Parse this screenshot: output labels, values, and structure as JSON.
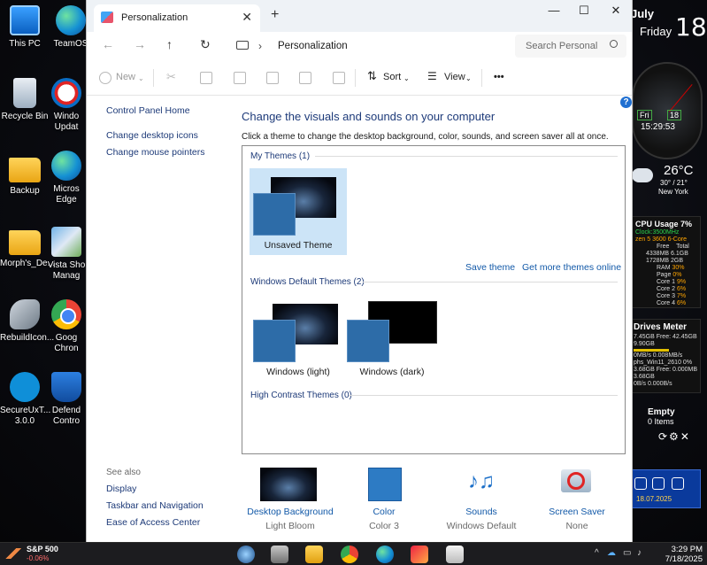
{
  "desktop": {
    "icons": [
      {
        "label": "This PC",
        "icon": "monitor-icon"
      },
      {
        "label": "TeamOS",
        "icon": "edge-icon"
      },
      {
        "label": "Recycle Bin",
        "icon": "recycle-bin-icon"
      },
      {
        "label": "Windo Updat",
        "icon": "blocked-icon"
      },
      {
        "label": "Backup",
        "icon": "folder-icon"
      },
      {
        "label": "Micros Edge",
        "icon": "edge-icon"
      },
      {
        "label": "Morph's_De...",
        "icon": "folder-icon"
      },
      {
        "label": "Vista Sho Manag",
        "icon": "vista-icon"
      },
      {
        "label": "RebuildIcon...",
        "icon": "tool-icon"
      },
      {
        "label": "Goog Chron",
        "icon": "chrome-icon"
      },
      {
        "label": "SecureUxT... 3.0.0",
        "icon": "brush-icon"
      },
      {
        "label": "Defend Contro",
        "icon": "shield-icon"
      }
    ]
  },
  "widgets": {
    "date": {
      "month": "July",
      "weekday": "Friday",
      "day": "18"
    },
    "clock": {
      "day_box": "Fri",
      "date_box": "18",
      "time": "15:29:53"
    },
    "weather": {
      "temp": "26°C",
      "range": "30° / 21°",
      "city": "New York"
    },
    "cpu": {
      "title": "CPU Usage",
      "percent": "7%",
      "clock": "Clock:3500MHz",
      "model": "zen 5 3600 6-Core",
      "free_h": "Free",
      "total_h": "Total",
      "mem1": "4338MB",
      "mem1_total": "6.1GB",
      "mem2": "1728MB",
      "mem2_total": "2GB",
      "rows": [
        {
          "k": "RAM",
          "v": "30%"
        },
        {
          "k": "Page",
          "v": "0%"
        },
        {
          "k": "Core 1",
          "v": "9%"
        },
        {
          "k": "Core 2",
          "v": "6%"
        },
        {
          "k": "Core 3",
          "v": "7%"
        },
        {
          "k": "Core 4",
          "v": "6%"
        }
      ]
    },
    "drives": {
      "title": "Drives Meter",
      "l1": "7.45GB",
      "l1b": "Free: 42.45GB",
      "l2": "9.90GB",
      "l3": "0MB/s",
      "l3b": "0.008MB/s",
      "l4": "phs_Win11_2610",
      "l4b": "0%",
      "l5": "3.68GB",
      "l5b": "Free: 0.000MB",
      "l6": "3.68GB",
      "l7": "0B/s",
      "l7b": "0.000B/s"
    },
    "recycle": {
      "title": "Empty",
      "items": "0 Items"
    },
    "apps": {
      "date": "18.07.2025"
    }
  },
  "window": {
    "tab_title": "Personalization",
    "controls": {
      "minimize": "—",
      "maximize": "☐",
      "close": "✕",
      "tab_close": "✕",
      "new_tab": "+"
    },
    "nav": {
      "back": "←",
      "forward": "→",
      "up": "↑",
      "refresh": "↻"
    },
    "address": {
      "separator": "›",
      "location": "Personalization"
    },
    "search": {
      "placeholder": "Search Personal"
    },
    "toolbar": {
      "new_label": "New",
      "sort_label": "Sort",
      "view_label": "View",
      "more_label": "•••"
    },
    "sidebar": {
      "links": [
        "Control Panel Home",
        "Change desktop icons",
        "Change mouse pointers"
      ],
      "see_also_title": "See also",
      "see_also": [
        "Display",
        "Taskbar and Navigation",
        "Ease of Access Center"
      ]
    },
    "main": {
      "heading": "Change the visuals and sounds on your computer",
      "subtext": "Click a theme to change the desktop background, color, sounds, and screen saver all at once.",
      "groups": {
        "my_themes": "My Themes (1)",
        "default_themes": "Windows Default Themes (2)",
        "high_contrast": "High Contrast Themes (0)"
      },
      "themes": {
        "unsaved": "Unsaved Theme",
        "light": "Windows (light)",
        "dark": "Windows (dark)"
      },
      "save_theme": "Save theme",
      "get_more": "Get more themes online"
    },
    "bottom": [
      {
        "label": "Desktop Background",
        "value": "Light Bloom"
      },
      {
        "label": "Color",
        "value": "Color 3"
      },
      {
        "label": "Sounds",
        "value": "Windows Default"
      },
      {
        "label": "Screen Saver",
        "value": "None"
      }
    ]
  },
  "taskbar": {
    "ticker": {
      "name": "S&P 500",
      "change": "-0.06%"
    },
    "time": "3:29 PM",
    "date": "7/18/2025"
  },
  "colors": {
    "accent": "#1259a8",
    "heading": "#1e3b7a",
    "selection": "#cce4f7"
  }
}
